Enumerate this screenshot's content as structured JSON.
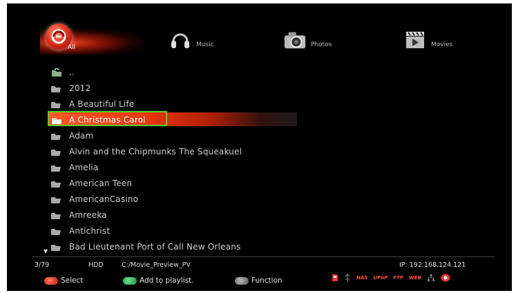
{
  "categories": {
    "all": "All",
    "music": "Music",
    "photos": "Photos",
    "movies": "Movies"
  },
  "files": [
    {
      "name": "..",
      "type": "parent"
    },
    {
      "name": "2012",
      "type": "folder"
    },
    {
      "name": "A Beautiful Life",
      "type": "folder"
    },
    {
      "name": "A Christmas Carol",
      "type": "folder-selected"
    },
    {
      "name": "Adam",
      "type": "folder"
    },
    {
      "name": "Alvin and the Chipmunks The Squeakuel",
      "type": "folder"
    },
    {
      "name": "Amelia",
      "type": "folder"
    },
    {
      "name": "American Teen",
      "type": "folder"
    },
    {
      "name": "AmericanCasino",
      "type": "folder"
    },
    {
      "name": "Amreeka",
      "type": "folder"
    },
    {
      "name": "Antichrist",
      "type": "folder"
    },
    {
      "name": "Bad Lieutenant Port of Call New Orleans",
      "type": "folder"
    }
  ],
  "status": {
    "position": "3/79",
    "device": "HDD",
    "path": "C:/Movie_Preview_PV",
    "ip": "IP: 192.168.124.121"
  },
  "buttons": {
    "select": "Select",
    "add_playlist": "Add to playlist.",
    "function": "Function"
  },
  "system_icons": {
    "nas": "NAS",
    "upnp": "UPnP",
    "ftp": "FTP",
    "web": "WEB"
  },
  "colors": {
    "accent": "#e8360f",
    "focus": "#4fd62a",
    "select_btn": "#e0331f",
    "playlist_btn": "#2faa55",
    "function_btn": "#888888"
  }
}
